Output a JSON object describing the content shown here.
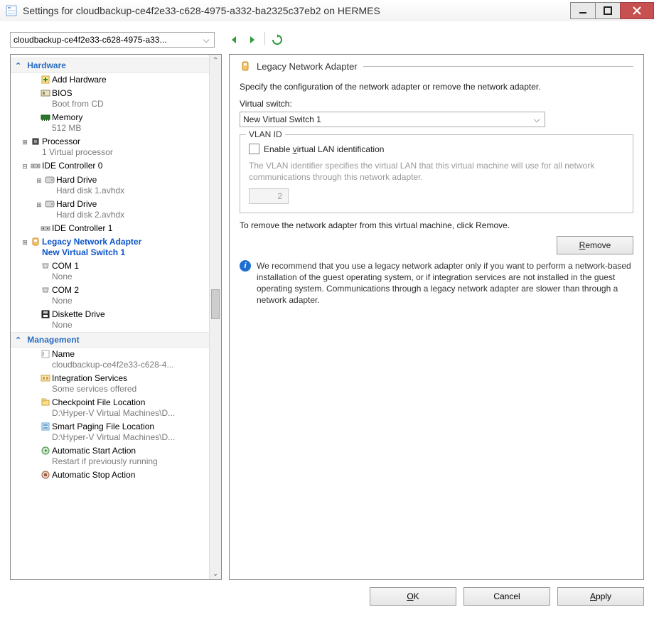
{
  "window": {
    "title": "Settings for cloudbackup-ce4f2e33-c628-4975-a332-ba2325c37eb2 on HERMES"
  },
  "toolbar": {
    "vm_selector": "cloudbackup-ce4f2e33-c628-4975-a33..."
  },
  "tree": {
    "section_hardware": "Hardware",
    "add_hardware": "Add Hardware",
    "bios": {
      "label": "BIOS",
      "sub": "Boot from CD"
    },
    "memory": {
      "label": "Memory",
      "sub": "512 MB"
    },
    "processor": {
      "label": "Processor",
      "sub": "1 Virtual processor"
    },
    "ide0": {
      "label": "IDE Controller 0"
    },
    "hdd1": {
      "label": "Hard Drive",
      "sub": "Hard disk 1.avhdx"
    },
    "hdd2": {
      "label": "Hard Drive",
      "sub": "Hard disk 2.avhdx"
    },
    "ide1": {
      "label": "IDE Controller 1"
    },
    "legacy_adapter": {
      "label": "Legacy Network Adapter",
      "sub": "New Virtual Switch 1"
    },
    "com1": {
      "label": "COM 1",
      "sub": "None"
    },
    "com2": {
      "label": "COM 2",
      "sub": "None"
    },
    "diskette": {
      "label": "Diskette Drive",
      "sub": "None"
    },
    "section_management": "Management",
    "name": {
      "label": "Name",
      "sub": "cloudbackup-ce4f2e33-c628-4..."
    },
    "integration": {
      "label": "Integration Services",
      "sub": "Some services offered"
    },
    "checkpoint": {
      "label": "Checkpoint File Location",
      "sub": "D:\\Hyper-V Virtual Machines\\D..."
    },
    "smartpaging": {
      "label": "Smart Paging File Location",
      "sub": "D:\\Hyper-V Virtual Machines\\D..."
    },
    "autostart": {
      "label": "Automatic Start Action",
      "sub": "Restart if previously running"
    },
    "autostop": {
      "label": "Automatic Stop Action"
    }
  },
  "detail": {
    "header": "Legacy Network Adapter",
    "description": "Specify the configuration of the network adapter or remove the network adapter.",
    "switch_label": "Virtual switch:",
    "switch_value": "New Virtual Switch 1",
    "vlan_legend": "VLAN ID",
    "vlan_enable_pre": "Enable ",
    "vlan_enable_u": "v",
    "vlan_enable_post": "irtual LAN identification",
    "vlan_help": "The VLAN identifier specifies the virtual LAN that this virtual machine will use for all network communications through this network adapter.",
    "vlan_value": "2",
    "remove_help": "To remove the network adapter from this virtual machine, click Remove.",
    "remove_u": "R",
    "remove_post": "emove",
    "info": "We recommend that you use a legacy network adapter only if you want to perform a network-based installation of the guest operating system, or if integration services are not installed in the guest operating system. Communications through a legacy network adapter are slower than through a network adapter."
  },
  "buttons": {
    "ok_u": "O",
    "ok_post": "K",
    "cancel": "Cancel",
    "apply_u": "A",
    "apply_post": "pply"
  }
}
